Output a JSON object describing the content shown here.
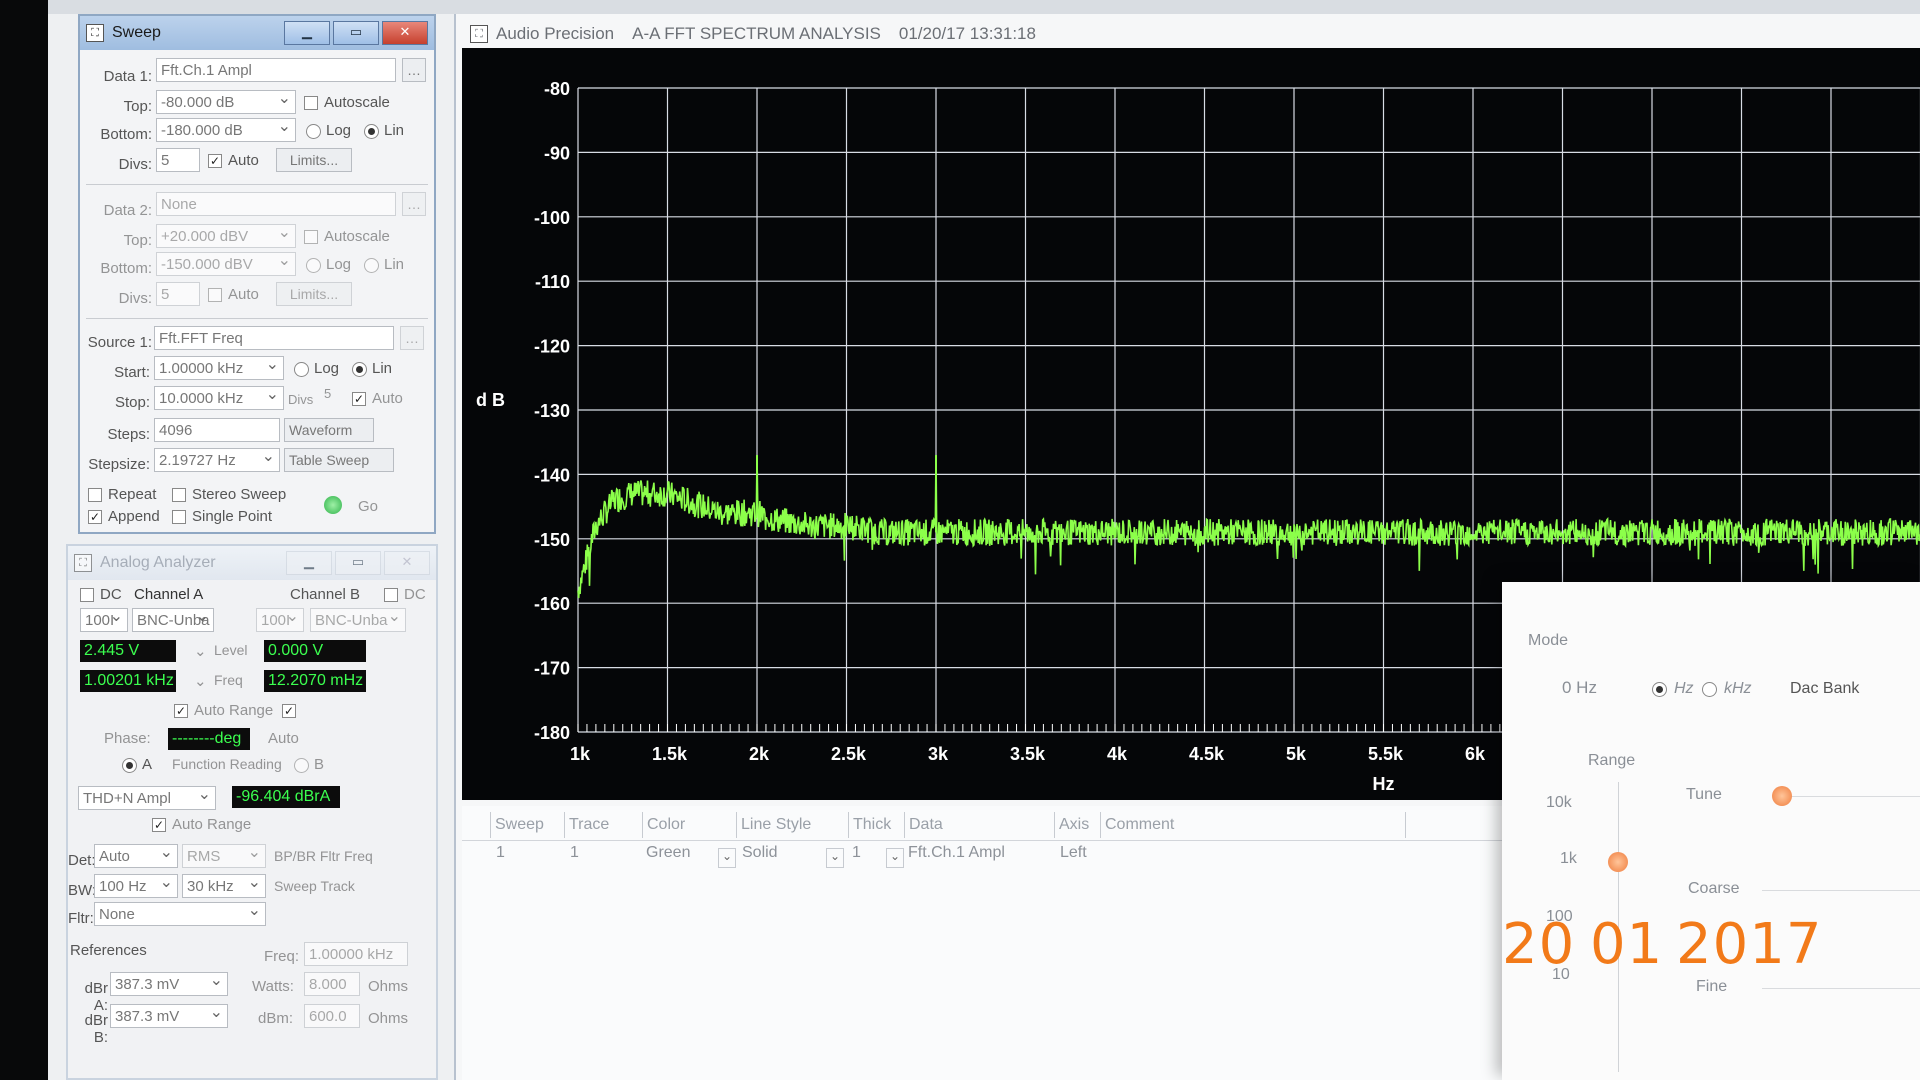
{
  "sweep": {
    "title": "Sweep",
    "data1": {
      "label": "Data 1:",
      "value": "Fft.Ch.1 Ampl",
      "top_label": "Top:",
      "top": "-80.000  dB",
      "bottom_label": "Bottom:",
      "bottom": "-180.000 dB",
      "autoscale": "Autoscale",
      "log": "Log",
      "lin": "Lin",
      "divs_label": "Divs:",
      "divs": "5",
      "auto": "Auto",
      "limits": "Limits..."
    },
    "data2": {
      "label": "Data 2:",
      "value": "None",
      "top_label": "Top:",
      "top": "+20.000  dBV",
      "bottom_label": "Bottom:",
      "bottom": "-150.000 dBV",
      "autoscale": "Autoscale",
      "log": "Log",
      "lin": "Lin",
      "divs_label": "Divs:",
      "divs": "5",
      "auto": "Auto",
      "limits": "Limits..."
    },
    "source1": {
      "label": "Source 1:",
      "value": "Fft.FFT Freq",
      "start_label": "Start:",
      "start": "1.00000 kHz",
      "log": "Log",
      "lin": "Lin",
      "stop_label": "Stop:",
      "stop": "10.0000 kHz",
      "divs_label": "Divs",
      "divs": "5",
      "auto": "Auto",
      "steps_label": "Steps:",
      "steps": "4096",
      "waveform": "Waveform",
      "stepsize_label": "Stepsize:",
      "stepsize": "2.19727  Hz",
      "table_sweep": "Table Sweep"
    },
    "repeat": "Repeat",
    "stereo": "Stereo Sweep",
    "append": "Append",
    "single": "Single Point",
    "go": "Go"
  },
  "analog": {
    "title": "Analog Analyzer",
    "dc": "DC",
    "channel_a": "Channel A",
    "channel_b": "Channel B",
    "range_a": "100I",
    "conn_a": "BNC-Unba",
    "range_b": "100I",
    "conn_b": "BNC-Unba",
    "level_a": "2.445  V",
    "level_label": "Level",
    "level_b": "0.000  V",
    "freq_a": "1.00201 kHz",
    "freq_label": "Freq",
    "freq_b": "12.2070 mHz",
    "auto_range": "Auto Range",
    "phase_label": "Phase:",
    "phase": "--------deg",
    "phase_mode": "Auto",
    "radio_a": "A",
    "function_reading": "Function Reading",
    "radio_b": "B",
    "function": "THD+N Ampl",
    "reading": "-96.404  dBrA",
    "auto_range2": "Auto Range",
    "det_label": "Det:",
    "det": "Auto",
    "rms": "RMS",
    "bp_label": "BP/BR Fltr Freq",
    "bw_label": "BW:",
    "bw_low": "100 Hz",
    "bw_high": "30 kHz",
    "sweep_track": "Sweep Track",
    "fltr_label": "Fltr:",
    "fltr": "None",
    "references": "References",
    "freq_ref_label": "Freq:",
    "freq_ref": "1.00000 kHz",
    "dbra_label": "dBr A:",
    "dbra": "387.3  mV",
    "watts_label": "Watts:",
    "watts": "8.000",
    "ohms1": "Ohms",
    "dbrb_label": "dBr B:",
    "dbrb": "387.3  mV",
    "dbm_label": "dBm:",
    "dbm": "600.0",
    "ohms2": "Ohms"
  },
  "graph": {
    "app": "Audio Precision",
    "title": "A-A FFT SPECTRUM ANALYSIS",
    "timestamp": "01/20/17 13:31:18",
    "y_unit": "d B",
    "x_unit": "Hz"
  },
  "chart_data": {
    "type": "line",
    "xlabel": "Hz",
    "ylabel": "dB",
    "xlim": [
      1000,
      10000
    ],
    "ylim": [
      -180,
      -80
    ],
    "grid": true,
    "x_ticks": [
      1000,
      1500,
      2000,
      2500,
      3000,
      3500,
      4000,
      4500,
      5000,
      5500,
      6000
    ],
    "x_tick_labels": [
      "1k",
      "1.5k",
      "2k",
      "2.5k",
      "3k",
      "3.5k",
      "4k",
      "4.5k",
      "5k",
      "5.5k",
      "6k"
    ],
    "y_ticks": [
      -80,
      -90,
      -100,
      -110,
      -120,
      -130,
      -140,
      -150,
      -160,
      -170,
      -180
    ],
    "series": [
      {
        "color": "#8cff4a",
        "x": [
          1000,
          1050,
          1100,
          1200,
          1300,
          1400,
          1500,
          1600,
          1700,
          1800,
          1900,
          2000,
          2100,
          2300,
          2500,
          2700,
          3000,
          3300,
          3600,
          4000,
          4500,
          5000,
          5500,
          6000,
          6500,
          7000,
          7300
        ],
        "y": [
          -158,
          -153,
          -148,
          -144,
          -143,
          -143,
          -143,
          -144,
          -145,
          -146,
          -146,
          -146,
          -147,
          -148,
          -148,
          -149,
          -149,
          -149,
          -149,
          -149,
          -149,
          -149,
          -149,
          -149,
          -149,
          -149,
          -149
        ]
      }
    ],
    "spurs": [
      {
        "x": 2000,
        "y": -137
      },
      {
        "x": 3000,
        "y": -137
      }
    ]
  },
  "table": {
    "headers": [
      "Sweep",
      "Trace",
      "Color",
      "Line Style",
      "Thick",
      "Data",
      "Axis",
      "Comment"
    ],
    "row": {
      "sweep": "1",
      "trace": "1",
      "color": "Green",
      "style": "Solid",
      "thick": "1",
      "data": "Fft.Ch.1 Ampl",
      "axis": "Left",
      "comment": ""
    }
  },
  "tuner": {
    "mode_label": "Mode",
    "freq": "0 Hz",
    "hz": "Hz",
    "khz": "kHz",
    "dac_bank": "Dac Bank",
    "range_label": "Range",
    "r10k": "10k",
    "r1k": "1k",
    "r100": "100",
    "r10": "10",
    "tune": "Tune",
    "coarse": "Coarse",
    "fine": "Fine"
  },
  "datestamp": {
    "day": "20",
    "month": "01",
    "year": "2017"
  },
  "colors": {
    "trace": "#8cff4a",
    "grid": "#d8dce4",
    "plot_bg": "#050608",
    "date": "#f27a19"
  }
}
